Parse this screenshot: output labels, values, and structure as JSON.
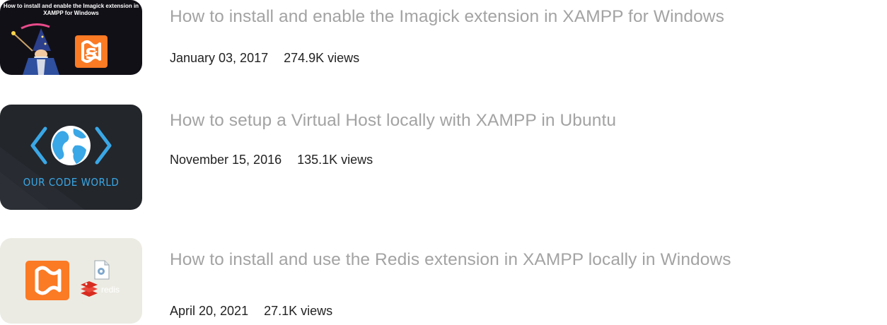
{
  "articles": [
    {
      "title": "How to install and enable the Imagick extension in XAMPP for Windows",
      "date": "January 03, 2017",
      "views": "274.9K views",
      "thumbnail": {
        "caption": "How to install and enable the Imagick extension in XAMPP for Windows",
        "icons": [
          "wizard-icon",
          "xampp-logo-icon"
        ],
        "colors": {
          "background": "#121017",
          "xampp": "#fb7a24"
        }
      }
    },
    {
      "title": "How to setup a Virtual Host locally with XAMPP in Ubuntu",
      "date": "November 15, 2016",
      "views": "135.1K views",
      "thumbnail": {
        "caption": "OUR CODE WORLD",
        "icons": [
          "globe-icon",
          "angle-brackets-icon"
        ],
        "colors": {
          "background": "#23262b",
          "accent": "#3aa7e6"
        }
      }
    },
    {
      "title": "How to install and use the Redis extension in XAMPP locally in Windows",
      "date": "April 20, 2021",
      "views": "27.1K views",
      "thumbnail": {
        "caption": "redis",
        "icons": [
          "xampp-logo-icon",
          "dll-file-icon",
          "redis-logo-icon"
        ],
        "colors": {
          "background": "#ecebe3",
          "xampp": "#fb7a24",
          "redis": "#d82c20"
        }
      }
    }
  ],
  "colors": {
    "title": "#a3a3a3",
    "meta": "#222222"
  }
}
